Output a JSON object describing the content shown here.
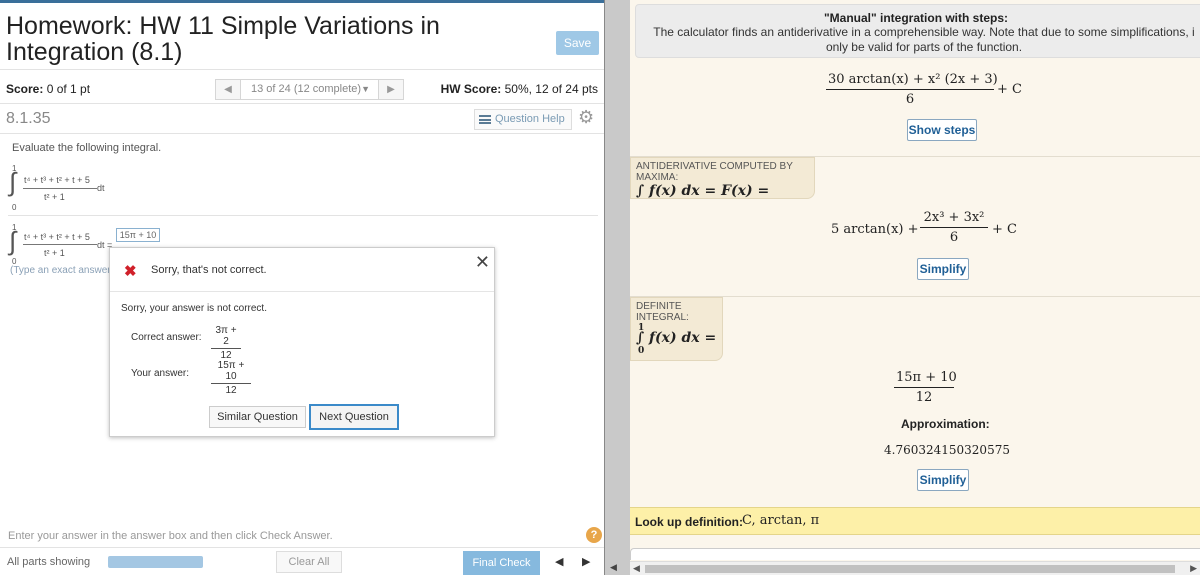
{
  "left": {
    "title": "Homework: HW 11 Simple Variations in Integration (8.1)",
    "save_label": "Save",
    "score_label": "Score:",
    "score_value": "0 of 1 pt",
    "nav_prev": "◀",
    "nav_position": "13 of 24 (12 complete)",
    "nav_caret": "▼",
    "nav_next": "▶",
    "hw_score_label": "HW Score:",
    "hw_score_value": "50%, 12 of 24 pts",
    "question_number": "8.1.35",
    "question_help": "Question Help",
    "gear": "⚙",
    "instruction": "Evaluate the following integral.",
    "integral": {
      "upper": "1",
      "lower": "0",
      "numerator": "t⁴ + t³ + t² + t + 5",
      "denominator": "t² + 1",
      "dt": "dt",
      "dt_equals": "dt ="
    },
    "answer_value": "15π + 10",
    "type_hint": "(Type an exact answer",
    "enter_hint": "Enter your answer in the answer box and then click Check Answer.",
    "help_symbol": "?",
    "parts_label": "All parts showing",
    "clear_label": "Clear All",
    "final_label": "Final Check",
    "bottom_prev": "◀",
    "bottom_next": "▶"
  },
  "dialog": {
    "x_symbol": "✖",
    "header_text": "Sorry, that's not correct.",
    "close": "✕",
    "message": "Sorry, your answer is not correct.",
    "correct_label": "Correct answer:",
    "correct_numerator": "3π + 2",
    "correct_denominator": "12",
    "your_label": "Your answer:",
    "your_numerator": "15π + 10",
    "your_denominator": "12",
    "similar_label": "Similar Question",
    "next_label": "Next Question"
  },
  "right": {
    "manual_title": "\"Manual\" integration with steps:",
    "manual_desc": "The calculator finds an antiderivative in a comprehensible way. Note that due to some simplifications, i only be valid for parts of the function.",
    "manual_result_numerator": "30 arctan(x) + x² (2x + 3)",
    "manual_result_denominator": "6",
    "manual_result_plus_c": "+ C",
    "show_steps_label": "Show steps",
    "maxima_tag_label": "ANTIDERIVATIVE COMPUTED BY MAXIMA:",
    "maxima_tag_math": "∫ f(x) dx = F(x) =",
    "maxima_prefix": "5 arctan(x) +",
    "maxima_numerator": "2x³ + 3x²",
    "maxima_denominator": "6",
    "maxima_plus_c": "+ C",
    "simplify_label_1": "Simplify",
    "definite_tag_label": "DEFINITE INTEGRAL:",
    "definite_upper": "1",
    "definite_lower": "0",
    "definite_math": "∫ f(x) dx =",
    "definite_numerator": "15π + 10",
    "definite_denominator": "12",
    "approx_label": "Approximation:",
    "approx_value": "4.760324150320575",
    "simplify_label_2": "Simplify",
    "lookup_label": "Look up definition:",
    "lookup_terms": "C, arctan, π",
    "scroll_left": "◀",
    "scroll_right": "▶"
  }
}
